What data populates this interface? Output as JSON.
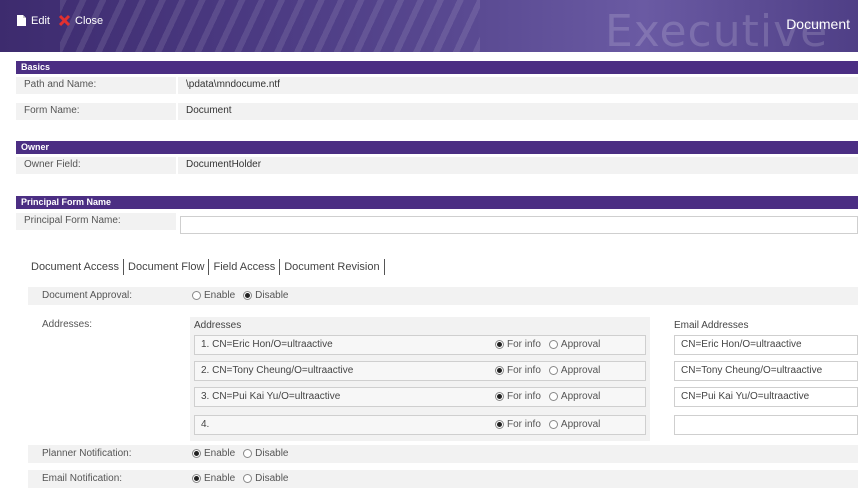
{
  "toolbar": {
    "edit_label": "Edit",
    "close_label": "Close",
    "watermark": "Executive",
    "title": "Document"
  },
  "basics": {
    "header": "Basics",
    "path_label": "Path and Name:",
    "path_value": "\\pdata\\mndocume.ntf",
    "form_label": "Form Name:",
    "form_value": "Document"
  },
  "owner": {
    "header": "Owner",
    "field_label": "Owner Field:",
    "field_value": "DocumentHolder"
  },
  "principal": {
    "header": "Principal Form Name",
    "label": "Principal Form Name:",
    "value": ""
  },
  "tabs": [
    {
      "label": "Document Access"
    },
    {
      "label": "Document Flow"
    },
    {
      "label": "Field Access"
    },
    {
      "label": "Document Revision"
    }
  ],
  "flow": {
    "approval_label": "Document Approval:",
    "enable_label": "Enable",
    "disable_label": "Disable",
    "approval_selected": "Disable",
    "addresses_label": "Addresses:",
    "addresses_col": "Addresses",
    "email_col": "Email Addresses",
    "for_info_label": "For info",
    "approval_opt_label": "Approval",
    "rows": [
      {
        "address": "1. CN=Eric Hon/O=ultraactive",
        "email": "CN=Eric Hon/O=ultraactive",
        "mode": "For info"
      },
      {
        "address": "2. CN=Tony Cheung/O=ultraactive",
        "email": "CN=Tony Cheung/O=ultraactive",
        "mode": "For info"
      },
      {
        "address": "3. CN=Pui Kai Yu/O=ultraactive",
        "email": "CN=Pui Kai Yu/O=ultraactive",
        "mode": "For info"
      },
      {
        "address": "4.",
        "email": "",
        "mode": "For info"
      }
    ],
    "planner_label": "Planner Notification:",
    "planner_selected": "Enable",
    "email_notify_label": "Email Notification:",
    "email_notify_selected": "Enable"
  }
}
